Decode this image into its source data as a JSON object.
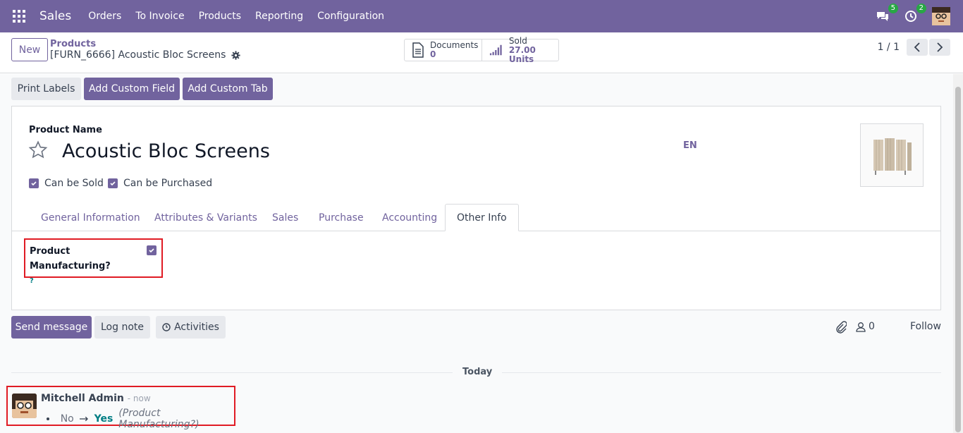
{
  "topbar": {
    "app_name": "Sales",
    "menu": [
      "Orders",
      "To Invoice",
      "Products",
      "Reporting",
      "Configuration"
    ],
    "messages_count": "5",
    "activities_count": "2"
  },
  "control": {
    "new_label": "New",
    "breadcrumb_parent": "Products",
    "breadcrumb_current": "[FURN_6666] Acoustic Bloc Screens",
    "documents_label": "Documents",
    "documents_value": "0",
    "sold_label": "Sold",
    "sold_value": "27.00 Units",
    "pager": "1 / 1"
  },
  "actions": {
    "print_labels": "Print Labels",
    "add_custom_field": "Add Custom Field",
    "add_custom_tab": "Add Custom Tab"
  },
  "form": {
    "product_name_label": "Product Name",
    "product_name": "Acoustic Bloc Screens",
    "lang": "EN",
    "can_be_sold": "Can be Sold",
    "can_be_purchased": "Can be Purchased",
    "tabs": [
      "General Information",
      "Attributes & Variants",
      "Sales",
      "Purchase",
      "Accounting",
      "Other Info"
    ],
    "active_tab": "Other Info",
    "mfg_label": "Product Manufacturing?",
    "mfg_help": "?"
  },
  "chatter": {
    "send_message": "Send message",
    "log_note": "Log note",
    "activities": "Activities",
    "followers_count": "0",
    "follow": "Follow",
    "today": "Today",
    "message": {
      "author": "Mitchell Admin",
      "time": "- now",
      "old_value": "No",
      "new_value": "Yes",
      "field": "(Product Manufacturing?)"
    }
  },
  "colors": {
    "brand": "#71639e",
    "highlight_border": "#e01b24",
    "teal": "#017e84"
  }
}
